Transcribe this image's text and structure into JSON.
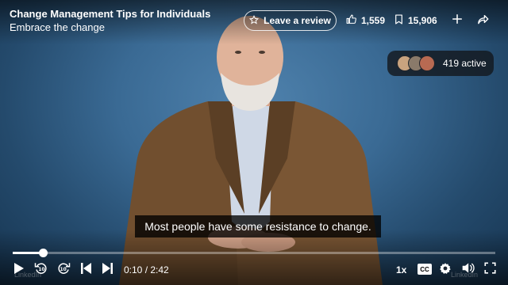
{
  "header": {
    "course_title": "Change Management Tips for Individuals",
    "chapter_title": "Embrace the change",
    "review_label": "Leave a review",
    "likes": "1,559",
    "saves": "15,906",
    "icons": {
      "review": "star-icon",
      "likes": "thumbs-up-icon",
      "saves": "bookmark-icon",
      "add": "plus-icon",
      "share": "share-arrow-icon"
    }
  },
  "viewers": {
    "active_label": "419 active"
  },
  "caption": {
    "text": "Most people have some resistance to change."
  },
  "player": {
    "time": "0:10 / 2:42",
    "progress": 0.062,
    "speed": "1x",
    "cc_label": "CC",
    "watermark_left": "LinkedIn",
    "watermark_right": "LinkedIn"
  },
  "colors": {
    "background": "#3a6a94",
    "caption_bg": "#000000",
    "progress": "#ffffff"
  }
}
